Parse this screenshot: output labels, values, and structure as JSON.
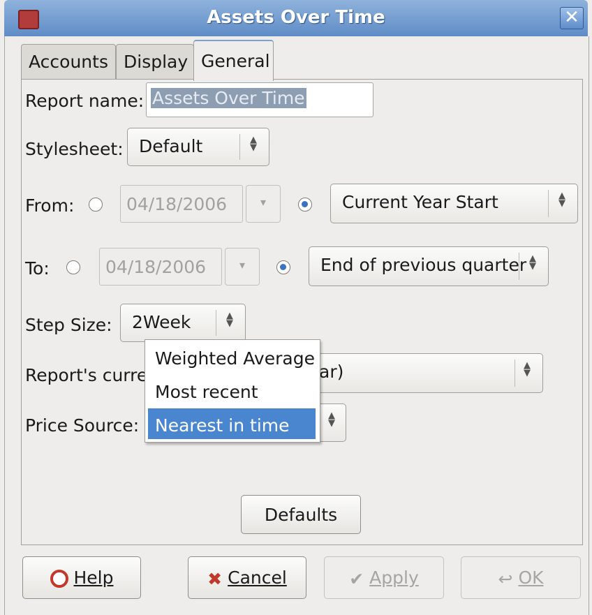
{
  "window": {
    "title": "Assets Over Time",
    "close_icon": "close-icon"
  },
  "tabs": [
    {
      "label": "Accounts"
    },
    {
      "label": "Display"
    },
    {
      "label": "General"
    }
  ],
  "form": {
    "report_name_label": "Report name:",
    "report_name_value": "Assets Over Time",
    "stylesheet_label": "Stylesheet:",
    "stylesheet_value": "Default",
    "from_label": "From:",
    "from_date": "04/18/2006",
    "from_relative": "Current Year Start",
    "to_label": "To:",
    "to_date": "04/18/2006",
    "to_relative": "End of previous quarter",
    "step_size_label": "Step Size:",
    "step_size_value": "2Week",
    "currency_label": "Report's currency:",
    "currency_value_visible": "ar)",
    "price_source_label": "Price Source:"
  },
  "price_source_popup": {
    "options": [
      "Weighted Average",
      "Most recent",
      "Nearest in time"
    ],
    "selected": "Nearest in time"
  },
  "defaults_button": "Defaults",
  "footer": {
    "help": "Help",
    "cancel": "Cancel",
    "apply": "Apply",
    "ok": "OK"
  }
}
